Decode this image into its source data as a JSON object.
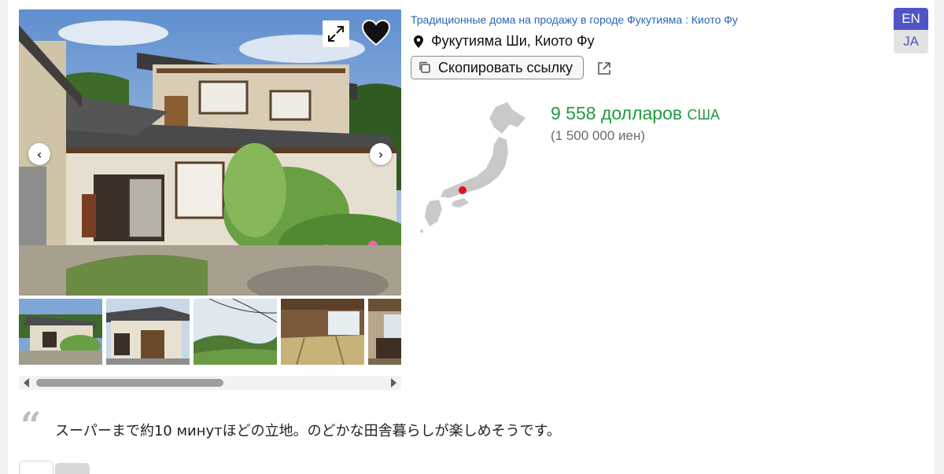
{
  "header": {
    "breadcrumb": "Традиционные дома на продажу в городе Фукутияма : Киото Фу",
    "location": "Фукутияма Ши, Киото Фу",
    "copy_link_label": "Скопировать ссылку"
  },
  "icons": {
    "location": "map-pin-icon",
    "copy": "copy-icon",
    "external": "external-link-icon",
    "expand": "expand-icon",
    "favorite": "heart-icon",
    "prev": "chevron-left-icon",
    "next": "chevron-right-icon"
  },
  "price": {
    "usd_value": "9 558 долларов",
    "usd_currency": "США",
    "jpy": "(1 500 000 иен)",
    "usd_color": "#229a41"
  },
  "languages": {
    "en": "EN",
    "ja": "JA",
    "active": "EN",
    "accent": "#4f55c7"
  },
  "gallery": {
    "thumbnails": [
      "house-front",
      "house-side",
      "landscape-powerlines",
      "interior-tatami",
      "interior-room"
    ]
  },
  "description": {
    "quote": "スーパーまで約10 минутほどの立地。のどかな田舎暮らしが楽しめそうです。"
  }
}
